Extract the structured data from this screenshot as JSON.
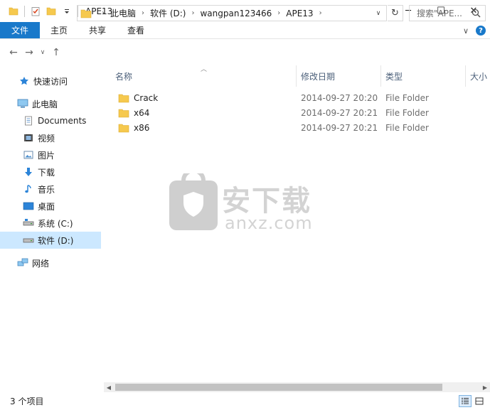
{
  "window": {
    "title": "APE13",
    "controls": {
      "minimize": "─",
      "maximize": "☐",
      "close": "✕"
    }
  },
  "ribbon": {
    "tabs": [
      "文件",
      "主页",
      "共享",
      "查看"
    ],
    "expand_glyph": "∨",
    "help_glyph": "?"
  },
  "nav": {
    "back": "←",
    "forward": "→",
    "recent": "∨",
    "up": "↑",
    "breadcrumb": [
      "此电脑",
      "软件 (D:)",
      "wangpan123466",
      "APE13"
    ],
    "crumb_sep": "›",
    "address_dropdown": "∨",
    "refresh": "↻",
    "search_placeholder": "搜索\"APE..."
  },
  "sidebar": {
    "items": [
      {
        "label": "快速访问",
        "icon": "star-icon",
        "level": 0
      },
      {
        "label": "此电脑",
        "icon": "computer-icon",
        "level": 0
      },
      {
        "label": "Documents",
        "icon": "documents-icon",
        "level": 1
      },
      {
        "label": "视频",
        "icon": "video-icon",
        "level": 1
      },
      {
        "label": "图片",
        "icon": "pictures-icon",
        "level": 1
      },
      {
        "label": "下载",
        "icon": "download-icon",
        "level": 1
      },
      {
        "label": "音乐",
        "icon": "music-icon",
        "level": 1
      },
      {
        "label": "桌面",
        "icon": "desktop-icon",
        "level": 1
      },
      {
        "label": "系统 (C:)",
        "icon": "drive-icon",
        "level": 1
      },
      {
        "label": "软件 (D:)",
        "icon": "drive-icon",
        "level": 1,
        "selected": true
      },
      {
        "label": "网络",
        "icon": "network-icon",
        "level": 0
      }
    ]
  },
  "columns": {
    "name": "名称",
    "date": "修改日期",
    "type": "类型",
    "size": "大小"
  },
  "files": [
    {
      "name": "Crack",
      "date": "2014-09-27 20:20",
      "type": "File Folder"
    },
    {
      "name": "x64",
      "date": "2014-09-27 20:21",
      "type": "File Folder"
    },
    {
      "name": "x86",
      "date": "2014-09-27 20:21",
      "type": "File Folder"
    }
  ],
  "watermark": {
    "cn": "安下载",
    "en": "anxz.com"
  },
  "status": {
    "item_count": "3 个项目"
  },
  "colors": {
    "accent": "#1979ca",
    "selection": "#cce8ff",
    "folder": "#f6c94e"
  }
}
